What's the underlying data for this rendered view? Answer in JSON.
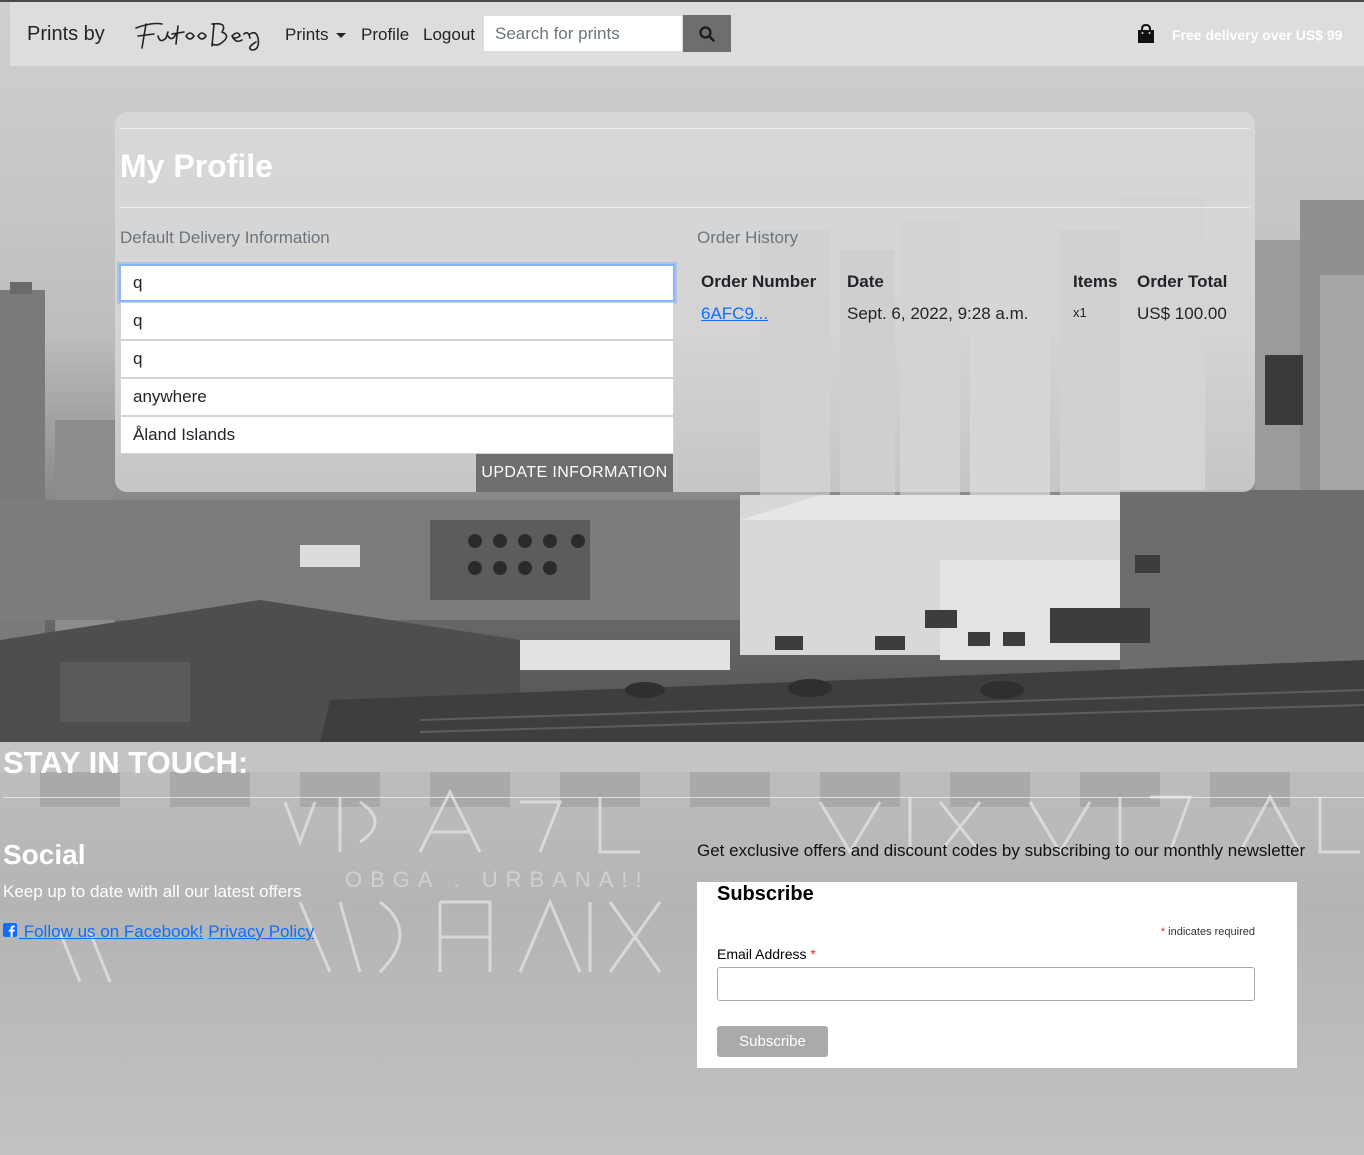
{
  "navbar": {
    "brand": "Prints by",
    "logo_text": "Futuro Berg",
    "prints_label": "Prints",
    "profile_label": "Profile",
    "logout_label": "Logout",
    "search_placeholder": "Search for prints",
    "search_icon": "search-icon",
    "bag_icon": "shopping-bag-icon",
    "delivery_text": "Free delivery over US$ 99"
  },
  "profile": {
    "title": "My Profile",
    "delivery_heading": "Default Delivery Information",
    "fields": [
      "q",
      "q",
      "q",
      "anywhere",
      "Åland Islands"
    ],
    "update_label": "UPDATE INFORMATION"
  },
  "orders": {
    "heading": "Order History",
    "columns": [
      "Order Number",
      "Date",
      "Items",
      "Order Total"
    ],
    "rows": [
      {
        "number": "6AFC9...",
        "date": "Sept. 6, 2022, 9:28 a.m.",
        "items": "x1",
        "total": "US$ 100.00"
      }
    ]
  },
  "footer": {
    "title": "STAY IN TOUCH:",
    "social_title": "Social",
    "social_text": "Keep up to date with all our latest offers",
    "facebook_label": " Follow us on Facebook!",
    "privacy_label": "Privacy Policy",
    "newsletter_text": "Get exclusive offers and discount codes by subscribing to our monthly newsletter",
    "subscribe_title": "Subscribe",
    "required_note": "indicates required",
    "required_star": "*",
    "email_label": "Email Address",
    "subscribe_button": "Subscribe"
  },
  "colors": {
    "button_grey": "#6e6e6e",
    "link_blue": "#0d6efd",
    "focus_blue": "#86b7fe",
    "required_red": "#e03131"
  }
}
